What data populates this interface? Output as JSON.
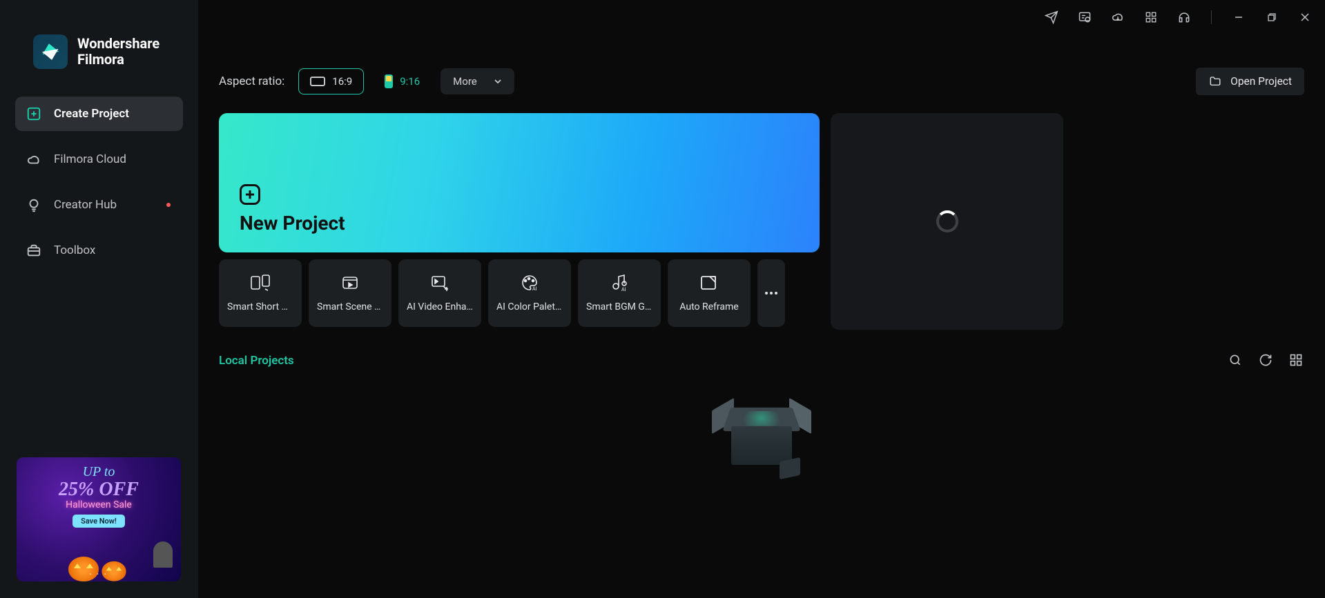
{
  "app": {
    "name1": "Wondershare",
    "name2": "Filmora"
  },
  "sidebar": {
    "items": [
      {
        "label": "Create Project",
        "icon": "plus-square-icon",
        "active": true
      },
      {
        "label": "Filmora Cloud",
        "icon": "cloud-icon"
      },
      {
        "label": "Creator Hub",
        "icon": "lightbulb-icon",
        "dot": true
      },
      {
        "label": "Toolbox",
        "icon": "toolbox-icon"
      }
    ]
  },
  "promo": {
    "line1": "UP to",
    "line2": "25% OFF",
    "line3": "Halloween Sale",
    "button": "Save Now!"
  },
  "titlebar_icons": [
    "send-icon",
    "feedback-icon",
    "cloud-download-icon",
    "apps-grid-icon",
    "headset-icon"
  ],
  "window_controls": [
    "minimize",
    "restore",
    "close"
  ],
  "top": {
    "aspect_label": "Aspect ratio:",
    "ratios": [
      {
        "label": "16:9",
        "selected": true
      },
      {
        "label": "9:16"
      }
    ],
    "more": "More",
    "open_project": "Open Project"
  },
  "hero": {
    "new_project": "New Project"
  },
  "tools": [
    {
      "label": "Smart Short Cli...",
      "icon": "short-clip-icon"
    },
    {
      "label": "Smart Scene Cut",
      "icon": "scene-cut-icon"
    },
    {
      "label": "AI Video Enhan...",
      "icon": "video-enhance-icon"
    },
    {
      "label": "AI Color Palette",
      "icon": "color-palette-icon"
    },
    {
      "label": "Smart BGM Ge...",
      "icon": "bgm-icon"
    },
    {
      "label": "Auto Reframe",
      "icon": "reframe-icon"
    }
  ],
  "local": {
    "title": "Local Projects"
  }
}
